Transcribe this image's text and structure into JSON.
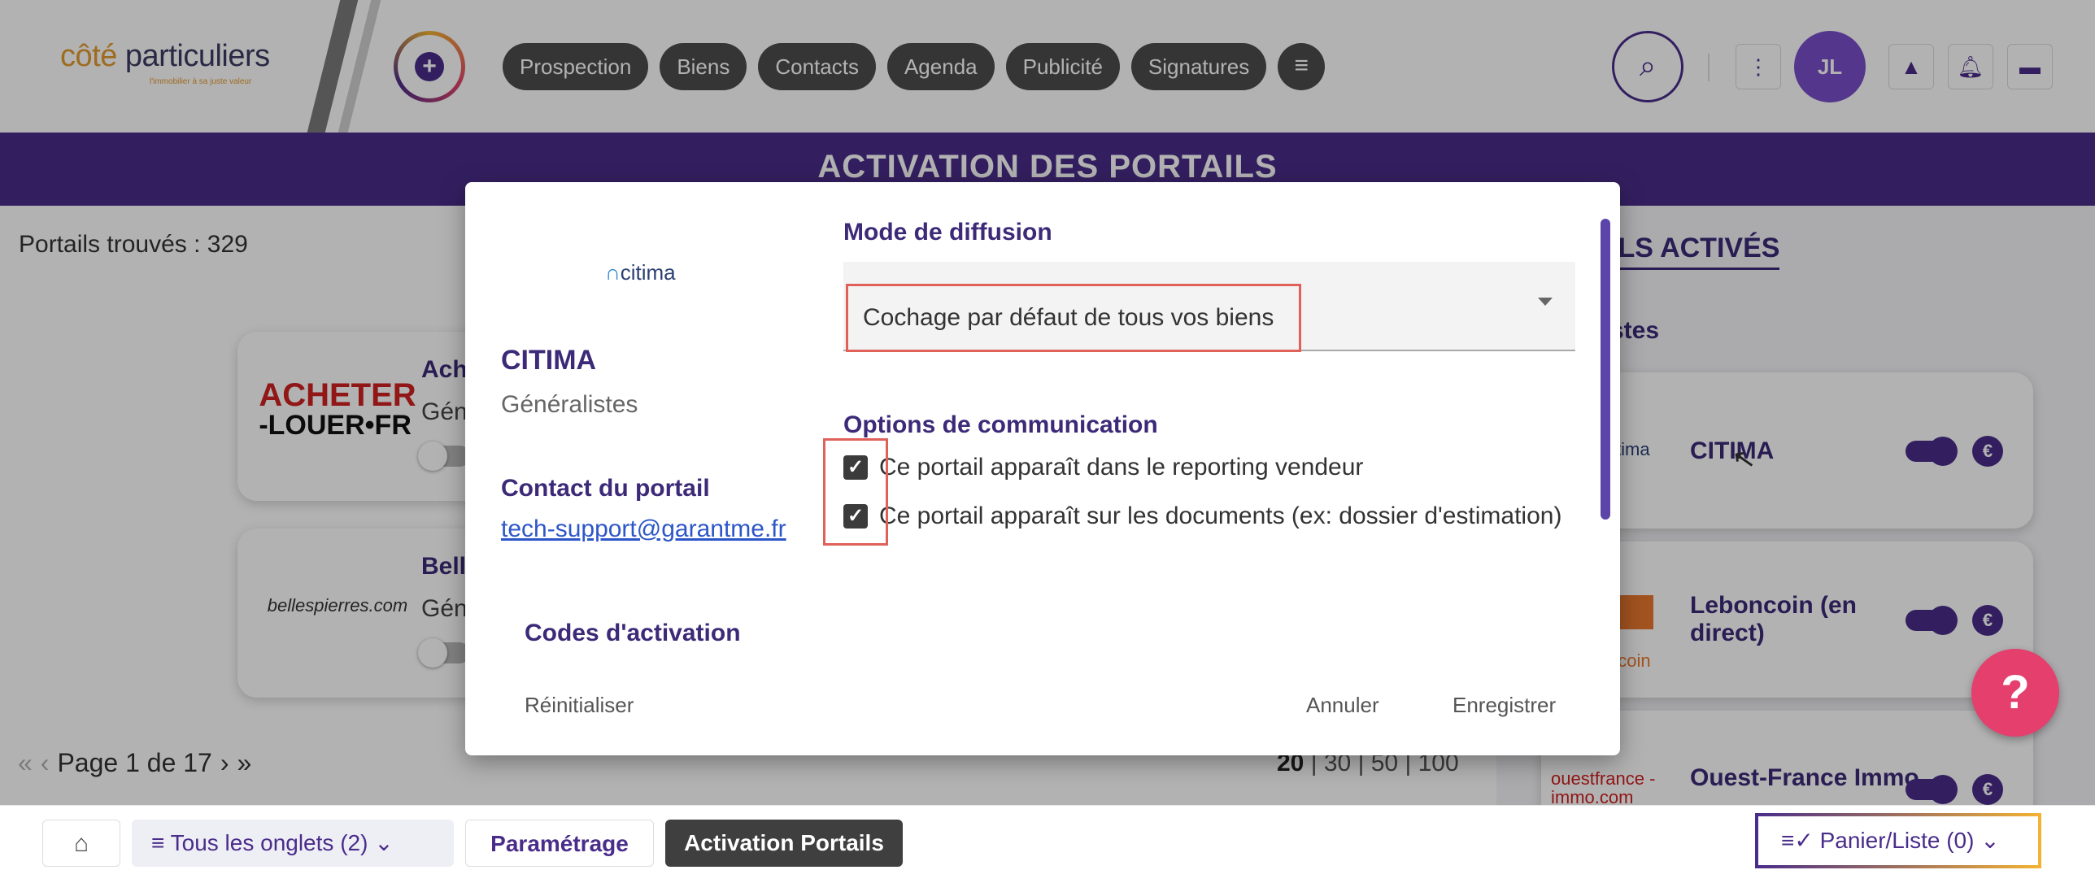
{
  "brand": {
    "name_part1": "côté",
    "name_part2": "particuliers",
    "tagline": "l'immobilier à sa juste valeur"
  },
  "nav": {
    "pills": [
      "Prospection",
      "Biens",
      "Contacts",
      "Agenda",
      "Publicité",
      "Signatures"
    ],
    "user_initials": "JL"
  },
  "page": {
    "title": "ACTIVATION DES PORTAILS",
    "found_label": "Portails trouvés : 329",
    "portals": [
      {
        "logo_line1": "ACHETER",
        "logo_line2": "-LOUER•FR",
        "title": "Ach",
        "subtitle": "Gén"
      },
      {
        "logo_text": "bellespierres.com",
        "title": "Bell",
        "subtitle": "Gén"
      }
    ],
    "pager": {
      "label": "Page 1 de 17",
      "sizes": [
        "20",
        "30",
        "50",
        "100"
      ],
      "separator": "|"
    }
  },
  "right_panel": {
    "heading": "ILS ACTIVÉS",
    "subheading": "stes",
    "items": [
      {
        "logo_text": "tima",
        "name": "CITIMA"
      },
      {
        "logo_text": "ncoin",
        "name": "Leboncoin (en direct)"
      },
      {
        "logo_text": "ouestfrance -immo.com",
        "name": "Ouest-France Immo"
      }
    ],
    "euro_symbol": "€"
  },
  "modal": {
    "logo_text": "citima",
    "portal_name": "CITIMA",
    "portal_category": "Généralistes",
    "contact_label": "Contact du portail",
    "contact_email": "tech-support@garantme.fr",
    "codes_label": "Codes d'activation",
    "mode_label": "Mode de diffusion",
    "mode_value": "Cochage par défaut de tous vos biens",
    "options_label": "Options de communication",
    "options": [
      {
        "label": "Ce portail apparaît dans le reporting vendeur",
        "checked": true
      },
      {
        "label": "Ce portail apparaît sur les documents (ex: dossier d'estimation)",
        "checked": true
      }
    ],
    "reset_label": "Réinitialiser",
    "cancel_label": "Annuler",
    "save_label": "Enregistrer"
  },
  "help_label": "?",
  "bottom_tabs": {
    "all_tabs_label": "Tous les onglets (2)",
    "settings_label": "Paramétrage",
    "active_label": "Activation Portails",
    "basket_label": "Panier/Liste (0)"
  },
  "colors": {
    "brand_purple": "#4a2d8a",
    "accent_orange": "#e39a2d",
    "highlight_red": "#e0605a",
    "help_pink": "#e53f6e"
  }
}
